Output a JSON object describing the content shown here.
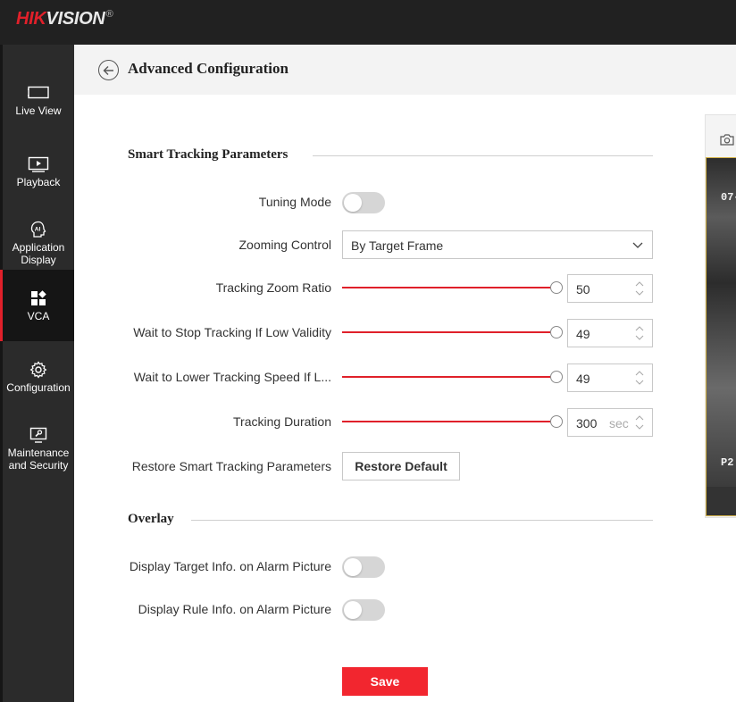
{
  "brand": {
    "part1": "HIK",
    "part2": "VISION",
    "reg": "®"
  },
  "sidebar": {
    "items": [
      {
        "label": "Live View",
        "icon": "monitor-icon"
      },
      {
        "label": "Playback",
        "icon": "playback-icon"
      },
      {
        "label": "Application Display",
        "icon": "ai-icon"
      },
      {
        "label": "VCA",
        "icon": "vca-grid-icon",
        "active": true
      },
      {
        "label": "Configuration",
        "icon": "gear-icon"
      },
      {
        "label": "Maintenance and Security",
        "icon": "maintenance-icon"
      }
    ]
  },
  "header": {
    "title": "Advanced Configuration"
  },
  "smart_tracking": {
    "section_title": "Smart Tracking Parameters",
    "tuning_mode": {
      "label": "Tuning Mode",
      "on": false
    },
    "zooming_control": {
      "label": "Zooming Control",
      "value": "By Target Frame"
    },
    "tracking_zoom_ratio": {
      "label": "Tracking Zoom Ratio",
      "value": "50",
      "level": 1.0
    },
    "wait_stop": {
      "label": "Wait to Stop Tracking If Low Validity",
      "value": "49",
      "level": 1.0
    },
    "wait_lower": {
      "label": "Wait to Lower Tracking Speed If L...",
      "value": "49",
      "level": 1.0
    },
    "tracking_duration": {
      "label": "Tracking Duration",
      "value": "300",
      "unit": "sec",
      "level": 1.0
    },
    "restore": {
      "label": "Restore Smart Tracking Parameters",
      "button": "Restore Default"
    }
  },
  "overlay": {
    "section_title": "Overlay",
    "target_info": {
      "label": "Display Target Info. on Alarm Picture",
      "on": false
    },
    "rule_info": {
      "label": "Display Rule Info. on Alarm Picture",
      "on": false
    }
  },
  "save_label": "Save",
  "preview": {
    "osd_top": "07-",
    "osd_bottom": "P2"
  },
  "colors": {
    "accent": "#e0202a",
    "save": "#f2262f",
    "sidebar_bg": "#2b2b2b",
    "topbar_bg": "#212121"
  }
}
